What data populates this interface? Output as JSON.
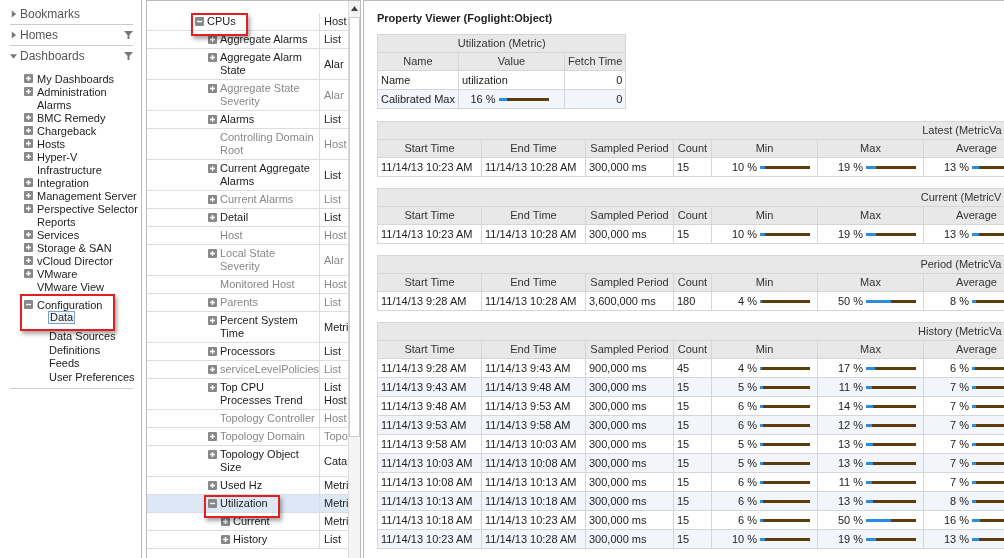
{
  "sidebar": {
    "sections": [
      {
        "label": "Bookmarks",
        "expanded": false,
        "filter": false
      },
      {
        "label": "Homes",
        "expanded": false,
        "filter": true
      },
      {
        "label": "Dashboards",
        "expanded": true,
        "filter": true,
        "items": [
          {
            "label": "My Dashboards",
            "kind": "node",
            "expanded": false,
            "selected": false,
            "highlighted": false
          },
          {
            "label": "Administration",
            "kind": "node",
            "expanded": false,
            "selected": false,
            "highlighted": false
          },
          {
            "label": "Alarms",
            "kind": "leaf",
            "selected": false,
            "highlighted": false
          },
          {
            "label": "BMC Remedy",
            "kind": "node",
            "expanded": false,
            "selected": false,
            "highlighted": false
          },
          {
            "label": "Chargeback",
            "kind": "node",
            "expanded": false,
            "selected": false,
            "highlighted": false
          },
          {
            "label": "Hosts",
            "kind": "node",
            "expanded": false,
            "selected": false,
            "highlighted": false
          },
          {
            "label": "Hyper-V",
            "kind": "node",
            "expanded": false,
            "selected": false,
            "highlighted": false
          },
          {
            "label": "Infrastructure",
            "kind": "leaf",
            "selected": false,
            "highlighted": false
          },
          {
            "label": "Integration",
            "kind": "node",
            "expanded": false,
            "selected": false,
            "highlighted": false
          },
          {
            "label": "Management Server",
            "kind": "node",
            "expanded": false,
            "selected": false,
            "highlighted": false
          },
          {
            "label": "Perspective Selector",
            "kind": "node",
            "expanded": false,
            "selected": false,
            "highlighted": false
          },
          {
            "label": "Reports",
            "kind": "leaf",
            "selected": false,
            "highlighted": false
          },
          {
            "label": "Services",
            "kind": "node",
            "expanded": false,
            "selected": false,
            "highlighted": false
          },
          {
            "label": "Storage & SAN",
            "kind": "node",
            "expanded": false,
            "selected": false,
            "highlighted": false
          },
          {
            "label": "vCloud Director",
            "kind": "node",
            "expanded": false,
            "selected": false,
            "highlighted": false
          },
          {
            "label": "VMware",
            "kind": "node",
            "expanded": false,
            "selected": false,
            "highlighted": false
          },
          {
            "label": "VMware View",
            "kind": "leaf",
            "selected": false,
            "highlighted": false
          },
          {
            "label": "Configuration",
            "kind": "node",
            "expanded": true,
            "selected": false,
            "highlighted": true,
            "children": [
              {
                "label": "Data",
                "kind": "leaf",
                "selected": true,
                "highlighted": false
              },
              {
                "label": "Data Sources",
                "kind": "leaf",
                "selected": false,
                "highlighted": false
              },
              {
                "label": "Definitions",
                "kind": "leaf",
                "selected": false,
                "highlighted": false
              },
              {
                "label": "Feeds",
                "kind": "leaf",
                "selected": false,
                "highlighted": false
              },
              {
                "label": "User Preferences",
                "kind": "leaf",
                "selected": false,
                "highlighted": false
              }
            ]
          }
        ]
      }
    ]
  },
  "property_tree": {
    "rows": [
      {
        "name": "CPUs",
        "type": "Host",
        "kind": "node",
        "expanded": true,
        "dimmed": false,
        "selected": false,
        "highlighted": true,
        "children": [
          {
            "name": "Aggregate Alarms",
            "type": "List",
            "kind": "node",
            "expanded": false,
            "dimmed": false,
            "selected": false,
            "highlighted": false
          },
          {
            "name": "Aggregate Alarm State",
            "type": "Alar",
            "kind": "node",
            "expanded": false,
            "dimmed": false,
            "selected": false,
            "highlighted": false
          },
          {
            "name": "Aggregate State Severity",
            "type": "Alar",
            "kind": "node",
            "expanded": false,
            "dimmed": true,
            "selected": false,
            "highlighted": false
          },
          {
            "name": "Alarms",
            "type": "List",
            "kind": "node",
            "expanded": false,
            "dimmed": false,
            "selected": false,
            "highlighted": false
          },
          {
            "name": "Controlling Domain Root",
            "type": "Host",
            "kind": "leaf",
            "dimmed": true,
            "selected": false,
            "highlighted": false
          },
          {
            "name": "Current Aggregate Alarms",
            "type": "List",
            "kind": "node",
            "expanded": false,
            "dimmed": false,
            "selected": false,
            "highlighted": false
          },
          {
            "name": "Current Alarms",
            "type": "List",
            "kind": "node",
            "expanded": false,
            "dimmed": true,
            "selected": false,
            "highlighted": false
          },
          {
            "name": "Detail",
            "type": "List",
            "kind": "node",
            "expanded": false,
            "dimmed": false,
            "selected": false,
            "highlighted": false
          },
          {
            "name": "Host",
            "type": "Host",
            "kind": "leaf",
            "dimmed": true,
            "selected": false,
            "highlighted": false
          },
          {
            "name": "Local State Severity",
            "type": "Alar",
            "kind": "node",
            "expanded": false,
            "dimmed": true,
            "selected": false,
            "highlighted": false
          },
          {
            "name": "Monitored Host",
            "type": "Host",
            "kind": "leaf",
            "dimmed": true,
            "selected": false,
            "highlighted": false
          },
          {
            "name": "Parents",
            "type": "List",
            "kind": "node",
            "expanded": false,
            "dimmed": true,
            "selected": false,
            "highlighted": false
          },
          {
            "name": "Percent System Time",
            "type": "Metri",
            "kind": "node",
            "expanded": false,
            "dimmed": false,
            "selected": false,
            "highlighted": false
          },
          {
            "name": "Processors",
            "type": "List",
            "kind": "node",
            "expanded": false,
            "dimmed": false,
            "selected": false,
            "highlighted": false
          },
          {
            "name": "serviceLevelPolicies",
            "type": "List",
            "kind": "node",
            "expanded": false,
            "dimmed": true,
            "selected": false,
            "highlighted": false
          },
          {
            "name": "Top CPU Processes Trend",
            "type": "List\nHost",
            "kind": "node",
            "expanded": false,
            "dimmed": false,
            "selected": false,
            "highlighted": false
          },
          {
            "name": "Topology Controller",
            "type": "Host",
            "kind": "leaf",
            "dimmed": true,
            "selected": false,
            "highlighted": false
          },
          {
            "name": "Topology Domain",
            "type": "Topo",
            "kind": "node",
            "expanded": false,
            "dimmed": true,
            "selected": false,
            "highlighted": false
          },
          {
            "name": "Topology Object Size",
            "type": "Cata",
            "kind": "node",
            "expanded": false,
            "dimmed": false,
            "selected": false,
            "highlighted": false
          },
          {
            "name": "Used Hz",
            "type": "Metri",
            "kind": "node",
            "expanded": false,
            "dimmed": false,
            "selected": false,
            "highlighted": false
          },
          {
            "name": "Utilization",
            "type": "Metri",
            "kind": "node",
            "expanded": true,
            "dimmed": false,
            "selected": true,
            "highlighted": true,
            "children": [
              {
                "name": "Current",
                "type": "Metri",
                "kind": "node",
                "expanded": false,
                "dimmed": false,
                "selected": false,
                "highlighted": false
              },
              {
                "name": "History",
                "type": "List",
                "kind": "node",
                "expanded": false,
                "dimmed": false,
                "selected": false,
                "highlighted": false
              }
            ]
          }
        ]
      }
    ]
  },
  "viewer": {
    "title": "Property Viewer (Foglight:Object)",
    "metric_table": {
      "title": "Utilization (Metric)",
      "columns": [
        "Name",
        "Value",
        "Fetch Time"
      ],
      "rows": [
        {
          "name": "Name",
          "value": "utilization",
          "fetch_time": "0"
        },
        {
          "name": "Calibrated Max",
          "value": "16 %",
          "level": 0.16,
          "fetch_time": "0"
        }
      ]
    },
    "value_tables": [
      {
        "title": "Latest (MetricVa",
        "columns": [
          "Start Time",
          "End Time",
          "Sampled Period",
          "Count",
          "Min",
          "Max",
          "Average"
        ],
        "rows": [
          {
            "start": "11/14/13 10:23 AM",
            "end": "11/14/13 10:28 AM",
            "period": "300,000 ms",
            "count": "15",
            "min": {
              "text": "10 %",
              "level": 0.1
            },
            "max": {
              "text": "19 %",
              "level": 0.19
            },
            "average": {
              "text": "13 %",
              "level": 0.13
            }
          }
        ]
      },
      {
        "title": "Current (MetricV",
        "columns": [
          "Start Time",
          "End Time",
          "Sampled Period",
          "Count",
          "Min",
          "Max",
          "Average"
        ],
        "rows": [
          {
            "start": "11/14/13 10:23 AM",
            "end": "11/14/13 10:28 AM",
            "period": "300,000 ms",
            "count": "15",
            "min": {
              "text": "10 %",
              "level": 0.1
            },
            "max": {
              "text": "19 %",
              "level": 0.19
            },
            "average": {
              "text": "13 %",
              "level": 0.13
            }
          }
        ]
      },
      {
        "title": "Period (MetricVa",
        "columns": [
          "Start Time",
          "End Time",
          "Sampled Period",
          "Count",
          "Min",
          "Max",
          "Average"
        ],
        "rows": [
          {
            "start": "11/14/13 9:28 AM",
            "end": "11/14/13 10:28 AM",
            "period": "3,600,000 ms",
            "count": "180",
            "min": {
              "text": "4 %",
              "level": 0.04
            },
            "max": {
              "text": "50 %",
              "level": 0.5
            },
            "average": {
              "text": "8 %",
              "level": 0.08
            }
          }
        ]
      },
      {
        "title": "History (MetricVa",
        "columns": [
          "Start Time",
          "End Time",
          "Sampled Period",
          "Count",
          "Min",
          "Max",
          "Average"
        ],
        "rows": [
          {
            "start": "11/14/13 9:28 AM",
            "end": "11/14/13 9:43 AM",
            "period": "900,000 ms",
            "count": "45",
            "min": {
              "text": "4 %",
              "level": 0.04
            },
            "max": {
              "text": "17 %",
              "level": 0.17
            },
            "average": {
              "text": "6 %",
              "level": 0.06
            }
          },
          {
            "start": "11/14/13 9:43 AM",
            "end": "11/14/13 9:48 AM",
            "period": "300,000 ms",
            "count": "15",
            "min": {
              "text": "5 %",
              "level": 0.05
            },
            "max": {
              "text": "11 %",
              "level": 0.11
            },
            "average": {
              "text": "7 %",
              "level": 0.07
            }
          },
          {
            "start": "11/14/13 9:48 AM",
            "end": "11/14/13 9:53 AM",
            "period": "300,000 ms",
            "count": "15",
            "min": {
              "text": "6 %",
              "level": 0.06
            },
            "max": {
              "text": "14 %",
              "level": 0.14
            },
            "average": {
              "text": "7 %",
              "level": 0.07
            }
          },
          {
            "start": "11/14/13 9:53 AM",
            "end": "11/14/13 9:58 AM",
            "period": "300,000 ms",
            "count": "15",
            "min": {
              "text": "6 %",
              "level": 0.06
            },
            "max": {
              "text": "12 %",
              "level": 0.12
            },
            "average": {
              "text": "7 %",
              "level": 0.07
            }
          },
          {
            "start": "11/14/13 9:58 AM",
            "end": "11/14/13 10:03 AM",
            "period": "300,000 ms",
            "count": "15",
            "min": {
              "text": "5 %",
              "level": 0.05
            },
            "max": {
              "text": "13 %",
              "level": 0.13
            },
            "average": {
              "text": "7 %",
              "level": 0.07
            }
          },
          {
            "start": "11/14/13 10:03 AM",
            "end": "11/14/13 10:08 AM",
            "period": "300,000 ms",
            "count": "15",
            "min": {
              "text": "5 %",
              "level": 0.05
            },
            "max": {
              "text": "13 %",
              "level": 0.13
            },
            "average": {
              "text": "7 %",
              "level": 0.07
            }
          },
          {
            "start": "11/14/13 10:08 AM",
            "end": "11/14/13 10:13 AM",
            "period": "300,000 ms",
            "count": "15",
            "min": {
              "text": "6 %",
              "level": 0.06
            },
            "max": {
              "text": "11 %",
              "level": 0.11
            },
            "average": {
              "text": "7 %",
              "level": 0.07
            }
          },
          {
            "start": "11/14/13 10:13 AM",
            "end": "11/14/13 10:18 AM",
            "period": "300,000 ms",
            "count": "15",
            "min": {
              "text": "6 %",
              "level": 0.06
            },
            "max": {
              "text": "13 %",
              "level": 0.13
            },
            "average": {
              "text": "8 %",
              "level": 0.08
            }
          },
          {
            "start": "11/14/13 10:18 AM",
            "end": "11/14/13 10:23 AM",
            "period": "300,000 ms",
            "count": "15",
            "min": {
              "text": "6 %",
              "level": 0.06
            },
            "max": {
              "text": "50 %",
              "level": 0.5
            },
            "average": {
              "text": "16 %",
              "level": 0.16
            }
          },
          {
            "start": "11/14/13 10:23 AM",
            "end": "11/14/13 10:28 AM",
            "period": "300,000 ms",
            "count": "15",
            "min": {
              "text": "10 %",
              "level": 0.1
            },
            "max": {
              "text": "19 %",
              "level": 0.19
            },
            "average": {
              "text": "13 %",
              "level": 0.13
            }
          }
        ]
      }
    ]
  }
}
